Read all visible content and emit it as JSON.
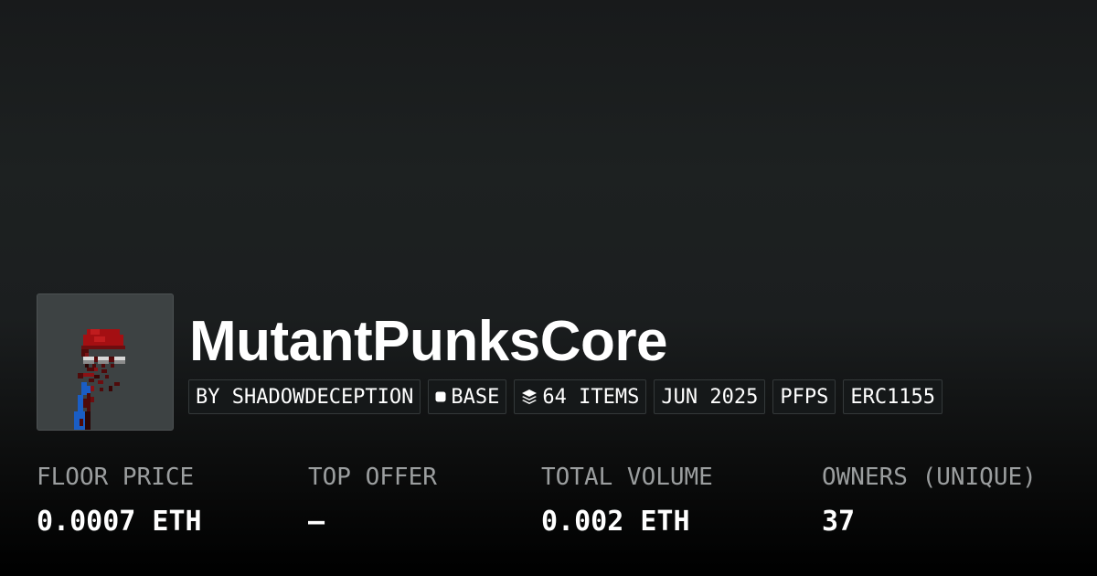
{
  "collection": {
    "name": "MutantPunksCore",
    "avatar_icon": "pixel-punk-avatar"
  },
  "tags": {
    "creator": "BY SHADOWDECEPTION",
    "chain": "BASE",
    "chain_icon": "base-chain-icon",
    "items": "64 ITEMS",
    "items_icon": "layers-icon",
    "date": "JUN 2025",
    "category": "PFPS",
    "standard": "ERC1155"
  },
  "stats": {
    "floor_price": {
      "label": "FLOOR PRICE",
      "value": "0.0007 ETH"
    },
    "top_offer": {
      "label": "TOP OFFER",
      "value": "—"
    },
    "total_volume": {
      "label": "TOTAL VOLUME",
      "value": "0.002 ETH"
    },
    "owners": {
      "label": "OWNERS (UNIQUE)",
      "value": "37"
    }
  },
  "colors": {
    "card_background": "#1d2121",
    "avatar_background": "#3d4243",
    "label_text": "#9b9e9f",
    "value_text": "#ffffff",
    "punk_red": "#a40f12",
    "punk_dark_red": "#4f0a0a",
    "punk_blue": "#1a5dc4"
  }
}
